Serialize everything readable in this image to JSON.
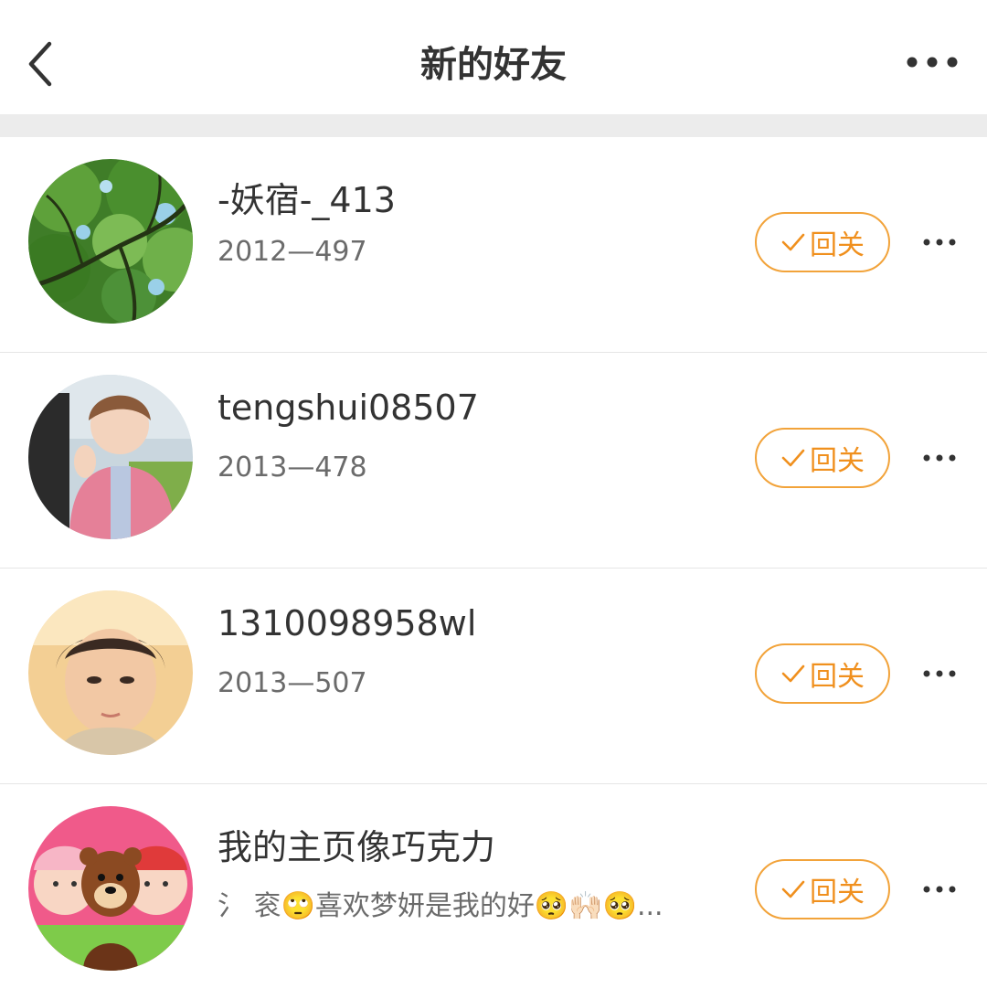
{
  "header": {
    "title": "新的好友",
    "back_icon": "chevron-left-icon",
    "more_icon": "more-horizontal-icon"
  },
  "colors": {
    "accent": "#f0901e",
    "divider": "#ececec",
    "text_primary": "#333333",
    "text_secondary": "#6b6b6b"
  },
  "friends": [
    {
      "name": "-妖宿-_413",
      "subtitle": "2012—497",
      "button_label": "回关",
      "avatar": "tree-canopy-photo"
    },
    {
      "name": "tengshui08507",
      "subtitle": "2013—478",
      "button_label": "回关",
      "avatar": "person-in-pink-jacket-photo"
    },
    {
      "name": "1310098958wl",
      "subtitle": "2013—507",
      "button_label": "回关",
      "avatar": "portrait-photo"
    },
    {
      "name": "我的主页像巧克力",
      "subtitle": "氵 衮🙄喜欢梦妍是我的好🥺🙌🏻🥺...",
      "button_label": "回关",
      "avatar": "cartoon-bear-and-babies"
    }
  ]
}
